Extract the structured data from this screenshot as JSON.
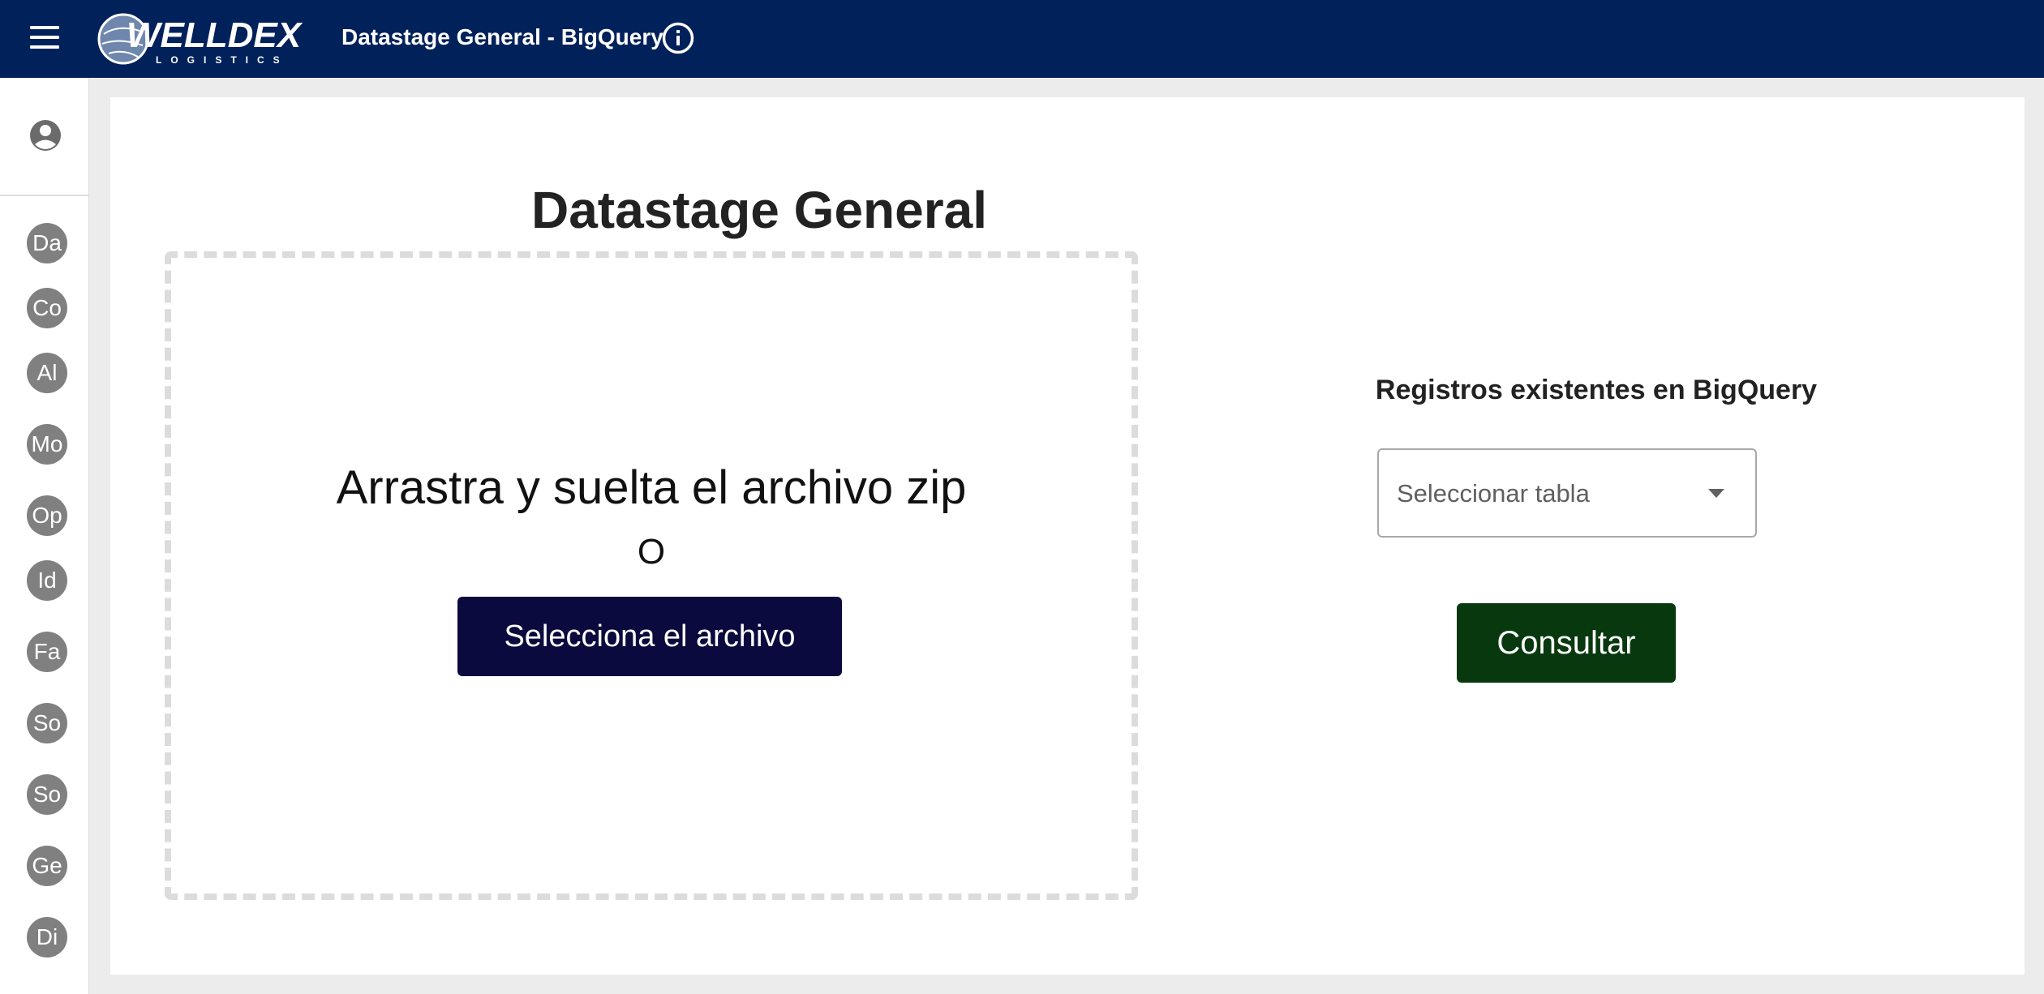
{
  "header": {
    "menu_icon": "hamburger-menu-icon",
    "logo_text": "WELLDEX",
    "logo_subtext": "LOGISTICS",
    "title": "Datastage General - BigQuery",
    "info_icon": "info-icon"
  },
  "sidebar": {
    "profile_icon": "account-circle-icon",
    "items": [
      {
        "label": "Da"
      },
      {
        "label": "Co"
      },
      {
        "label": "Al"
      },
      {
        "label": "Mo"
      },
      {
        "label": "Op"
      },
      {
        "label": "Id"
      },
      {
        "label": "Fa"
      },
      {
        "label": "So"
      },
      {
        "label": "So"
      },
      {
        "label": "Ge"
      },
      {
        "label": "Di"
      }
    ]
  },
  "main": {
    "title": "Datastage General",
    "dropzone": {
      "instruction": "Arrastra y suelta el archivo zip",
      "or": "O",
      "select_button": "Selecciona el archivo"
    },
    "bigquery": {
      "heading": "Registros existentes en BigQuery",
      "select_placeholder": "Seleccionar tabla",
      "query_button": "Consultar"
    }
  },
  "colors": {
    "header_bg": "#00215a",
    "select_file_button": "#0b0a3e",
    "consultar_button": "#08390e",
    "sidebar_avatar": "#808080"
  }
}
